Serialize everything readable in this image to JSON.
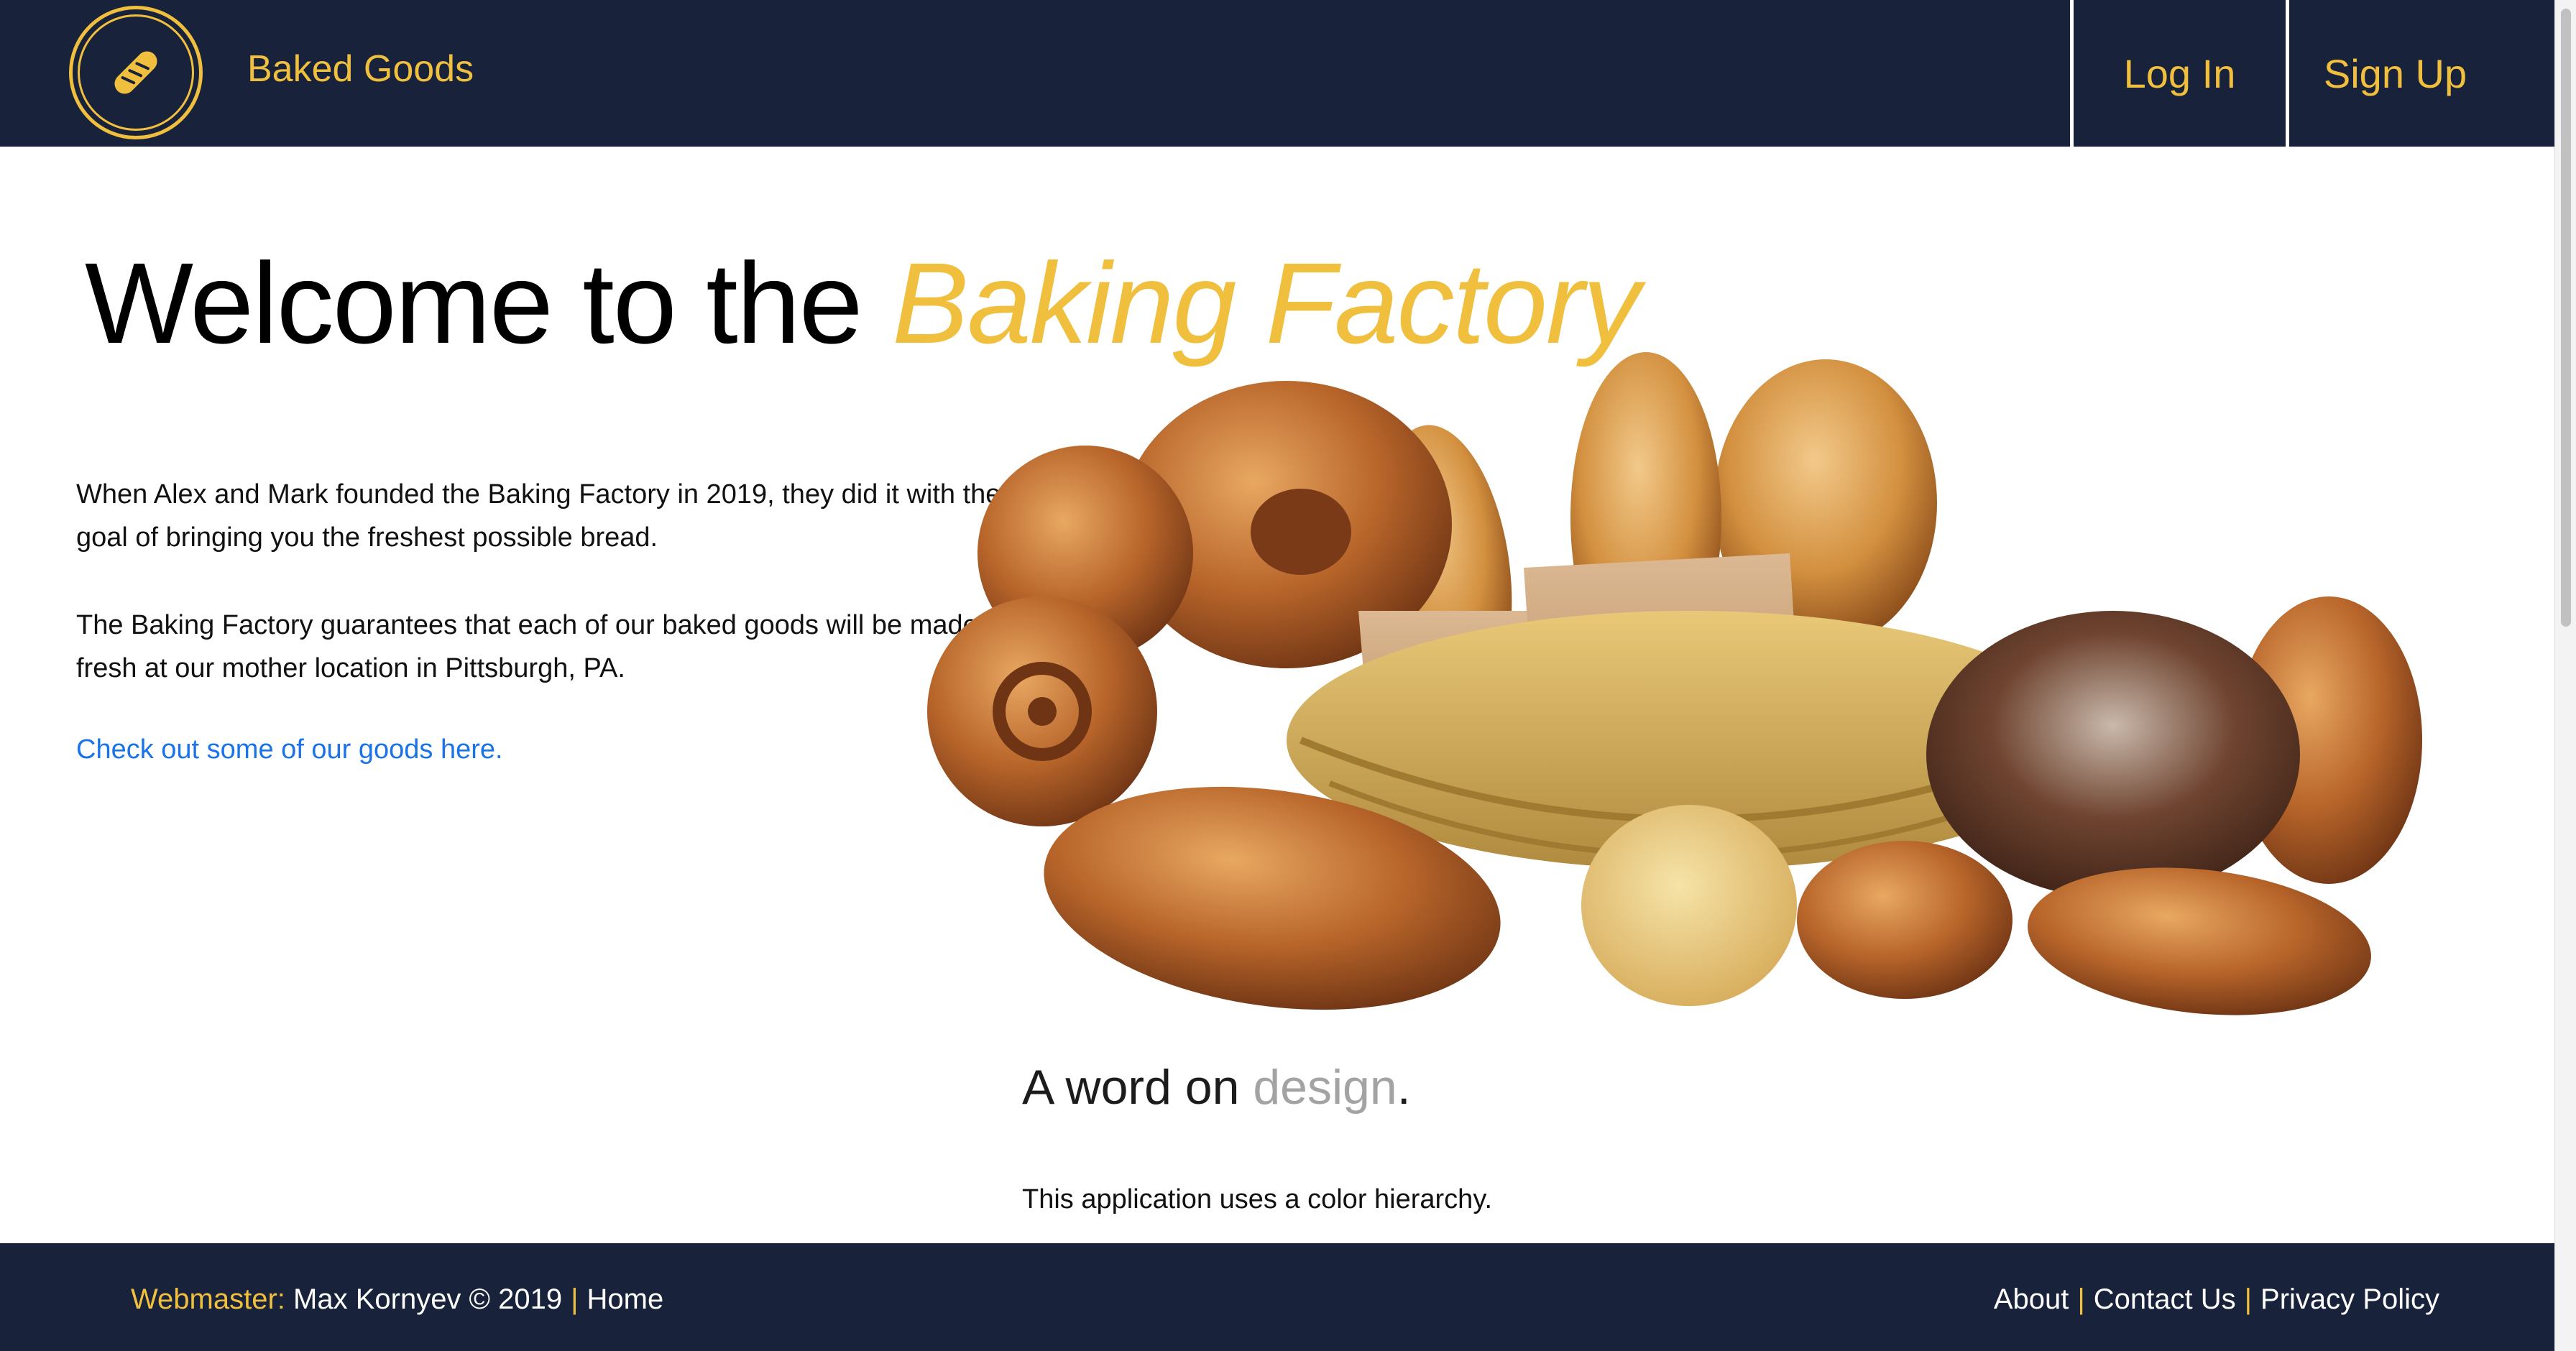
{
  "header": {
    "brand": "Baked Goods",
    "logo_icon": "baguette-icon",
    "nav": {
      "login": "Log In",
      "signup": "Sign Up"
    }
  },
  "main": {
    "title_plain": "Welcome to the ",
    "title_accent": "Baking Factory",
    "paragraph_1": "When Alex and Mark founded the Baking Factory in 2019, they did it with the goal of bringing you the freshest possible bread.",
    "paragraph_2": "The Baking Factory guarantees that each of our baked goods will be made fresh at our mother location in Pittsburgh, PA.",
    "goods_link": "Check out some of our goods here.",
    "section_title_start": "A word on ",
    "section_title_accent": "design",
    "section_title_end": ".",
    "section_text": "This application uses a color hierarchy."
  },
  "footer": {
    "webmaster_label": "Webmaster:",
    "webmaster_text": "Max Kornyev © 2019",
    "separator": "|",
    "home": "Home",
    "about": "About",
    "contact": "Contact Us",
    "privacy": "Privacy Policy"
  },
  "colors": {
    "header_bg": "#18223b",
    "accent": "#f0bf3e",
    "link": "#1a73e8",
    "muted": "#a3a3a3"
  }
}
